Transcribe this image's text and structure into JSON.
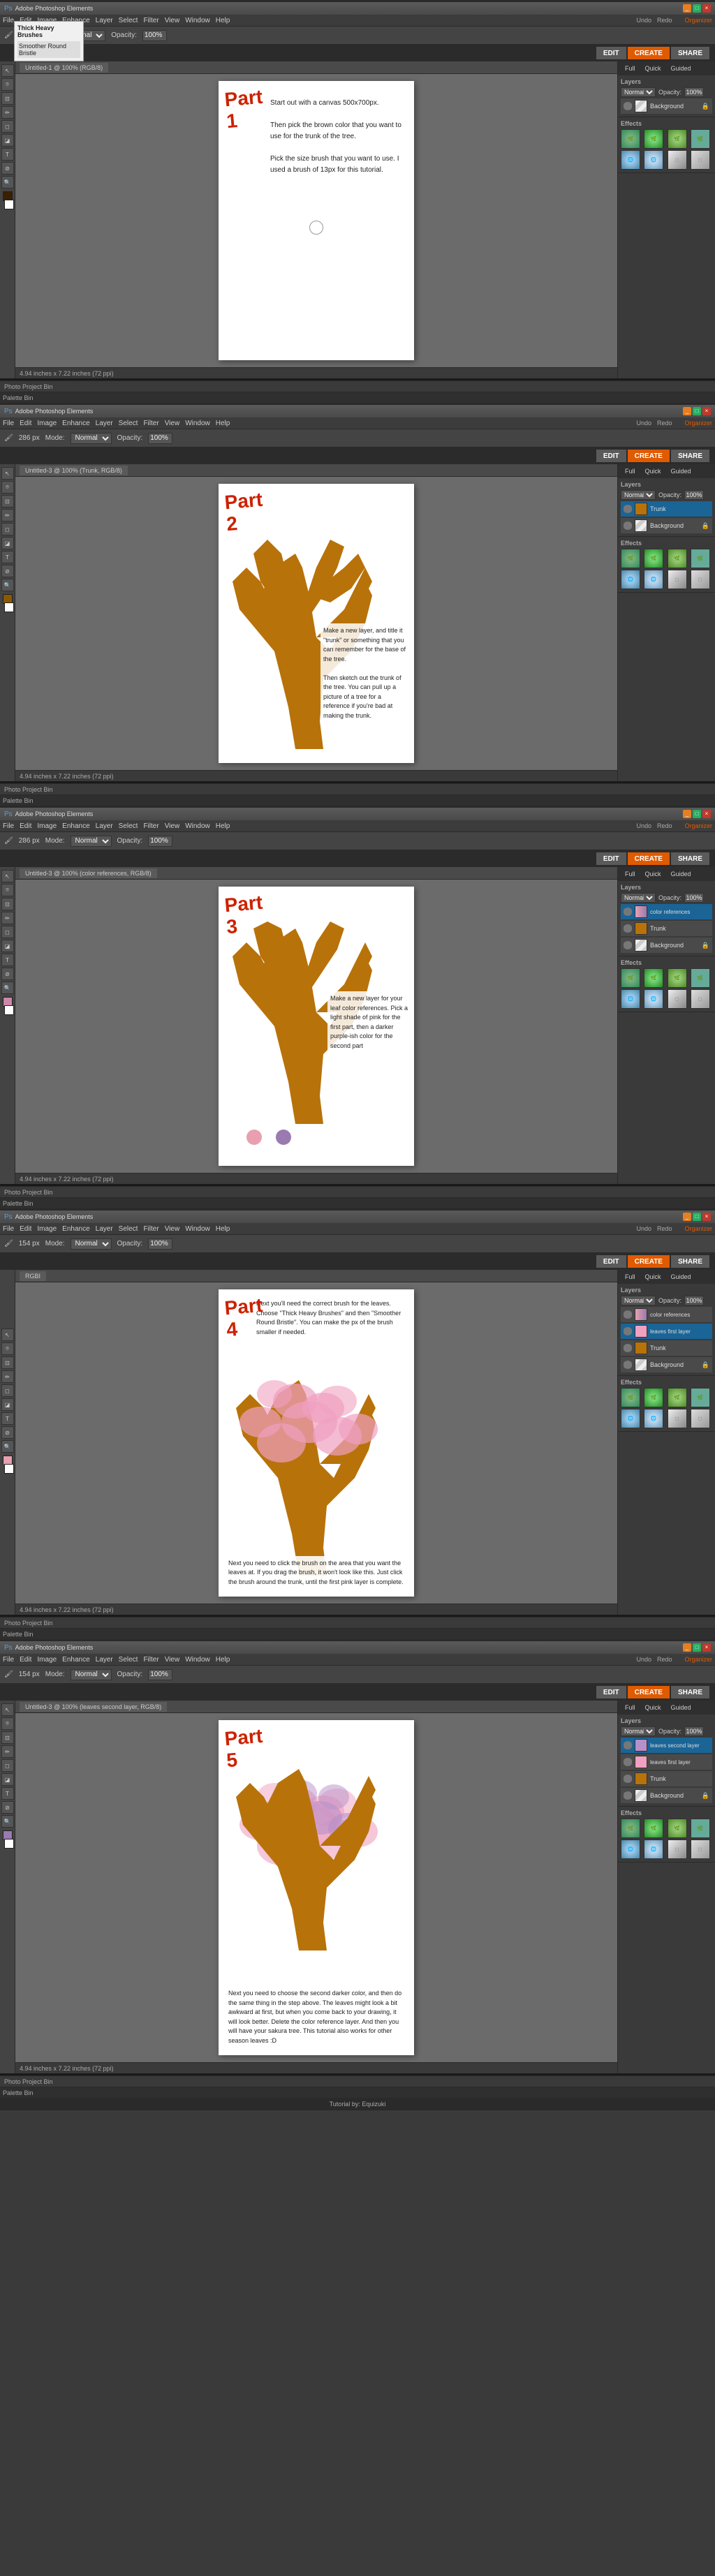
{
  "app": {
    "title": "Adobe Photoshop Elements",
    "organizer_label": "Organizer"
  },
  "menu": {
    "items": [
      "File",
      "Edit",
      "Image",
      "Enhance",
      "Layer",
      "Select",
      "Filter",
      "View",
      "Window",
      "Help"
    ]
  },
  "toolbar": {
    "undo": "Undo",
    "redo": "Redo",
    "organizer": "Organizer",
    "brush_size_label": "286",
    "mode_label": "Mode:",
    "mode_value": "Normal",
    "opacity_label": "Opacity:",
    "opacity_value": "100%"
  },
  "ecs": {
    "edit": "EDIT",
    "create": "CREATE",
    "share": "SHARE"
  },
  "panel": {
    "tabs": [
      "Full",
      "Quick",
      "Guided"
    ],
    "layers_title": "Layers",
    "effects_title": "Effects",
    "palette_bin": "Palette Bin"
  },
  "sections": [
    {
      "id": "part1",
      "part_label": "Part\n1",
      "tab_title": "Untitled-1 @ 100% (RGB/8)",
      "status": "4.94 inches x 7.22 inches (72 ppi)",
      "project_bin": "Photo Project Bin",
      "tutorial_text": "Start out with a canvas 500x700px.\n\nThen pick the brown color that you want to use for the trunk of the tree.\n\nPick the size brush that you want to use. I used a brush of 13px for this tutorial.",
      "layers": [
        {
          "name": "Background",
          "active": false
        }
      ],
      "doc_width": 260,
      "doc_height": 370
    },
    {
      "id": "part2",
      "part_label": "Part\n2",
      "tab_title": "Untitled-3 @ 100% (Trunk, RGB/8)",
      "status": "4.94 inches x 7.22 inches (72 ppi)",
      "project_bin": "Photo Project Bin",
      "tutorial_text": "Make a new layer, and title it \"trunk\" or something that you can remember for the base of the tree.\n\nThen sketch out the trunk of the tree. You can pull up a picture of a tree for a reference if you're bad at making the trunk.",
      "layers": [
        {
          "name": "Trunk",
          "active": true
        },
        {
          "name": "Background",
          "active": false
        }
      ],
      "doc_width": 260,
      "doc_height": 370
    },
    {
      "id": "part3",
      "part_label": "Part\n3",
      "tab_title": "Untitled-3 @ 100% (color references, RGB/8)",
      "status": "4.94 inches x 7.22 inches (72 ppi)",
      "project_bin": "Photo Project Bin",
      "tutorial_text": "Make a new layer for your leaf color references. Pick a light shade of pink for the first part, then a darker purple-ish color for the second part",
      "layers": [
        {
          "name": "color references",
          "active": true
        },
        {
          "name": "Trunk",
          "active": false
        },
        {
          "name": "Background",
          "active": false
        }
      ],
      "doc_width": 260,
      "doc_height": 370
    },
    {
      "id": "part4",
      "part_label": "Part\n4",
      "tab_title": "RGBI",
      "status": "4.94 inches x 7.22 inches (72 ppi)",
      "project_bin": "Photo Project Bin",
      "brush_picker_title": "Thick Heavy Brushes",
      "brush_picker_item": "Smoother Round Bristle",
      "tutorial_text": "Next you'll need the correct brush for the leaves. Choose \"Thick Heavy Brushes\" and then \"Smoother Round Bristle\". You can make the px of the brush smaller if needed.\n\nNext you need to click the brush on the area that you want the leaves at. If you drag the brush, it won't look like this. Just click the brush around the trunk, until the first pink layer is complete.",
      "layers": [
        {
          "name": "color references",
          "active": false
        },
        {
          "name": "leaves first layer",
          "active": true
        },
        {
          "name": "Trunk",
          "active": false
        },
        {
          "name": "Background",
          "active": false
        }
      ],
      "doc_width": 260,
      "doc_height": 370
    },
    {
      "id": "part5",
      "part_label": "Part\n5",
      "tab_title": "Untitled-3 @ 100% (leaves second layer, RGB/8)",
      "status": "4.94 inches x 7.22 inches (72 ppi)",
      "project_bin": "Photo Project Bin",
      "tutorial_text": "Next you need to choose the second darker color, and then do the same thing in the step above. The leaves might look a bit awkward at first, but when you come back to your drawing, it will look better. Delete the color reference layer. And then you will have your sakura tree. This tutorial also works for other season leaves :D",
      "layers": [
        {
          "name": "leaves second layer",
          "active": true
        },
        {
          "name": "leaves first layer",
          "active": false
        },
        {
          "name": "Trunk",
          "active": false
        },
        {
          "name": "Background",
          "active": false
        }
      ],
      "doc_width": 260,
      "doc_height": 370
    }
  ],
  "footer": {
    "credit": "Tutorial by: Equizuki"
  }
}
